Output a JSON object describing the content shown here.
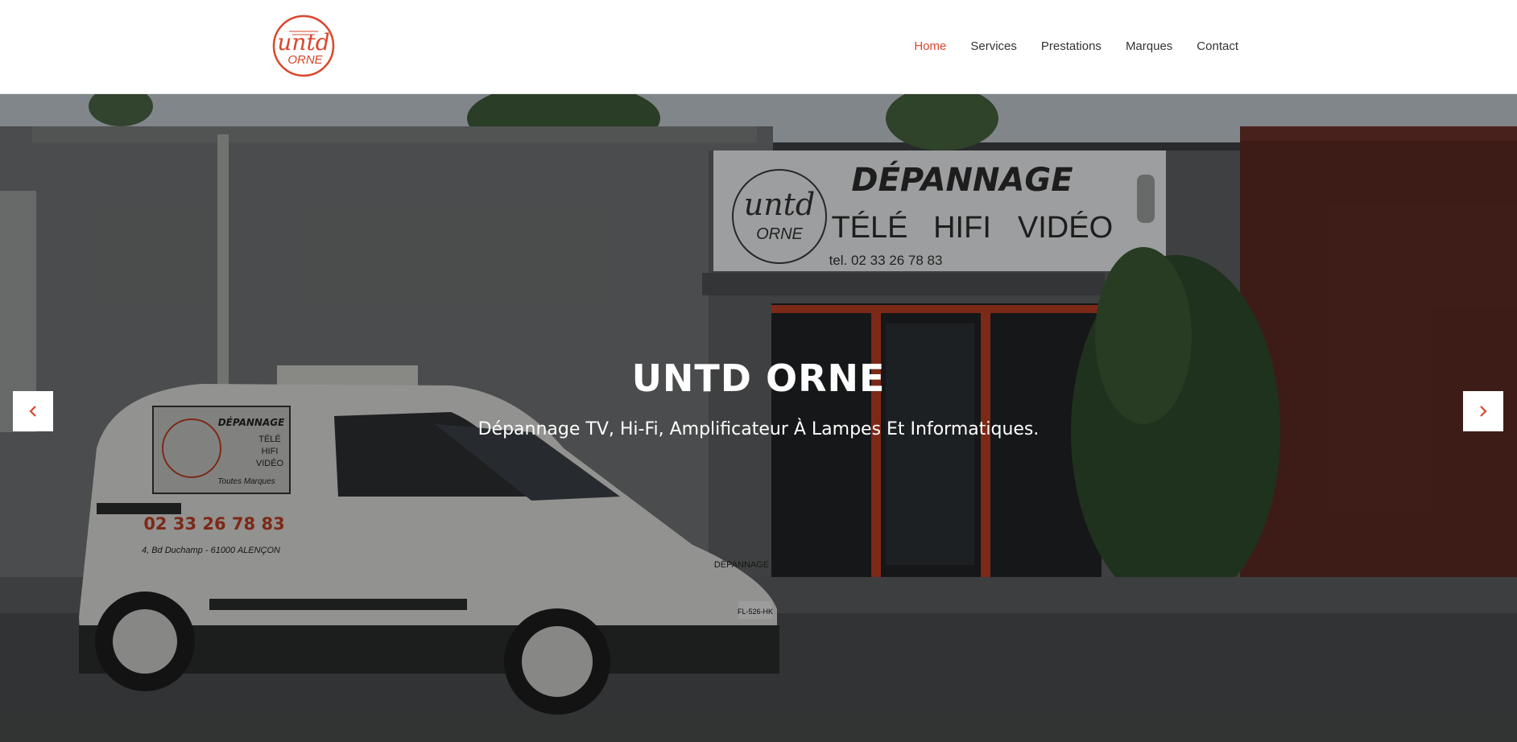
{
  "brand": {
    "logo_text_top": "untd",
    "logo_text_bottom": "ORNE",
    "accent_color": "#d9472b"
  },
  "nav": {
    "items": [
      {
        "label": "Home",
        "active": true
      },
      {
        "label": "Services",
        "active": false
      },
      {
        "label": "Prestations",
        "active": false
      },
      {
        "label": "Marques",
        "active": false
      },
      {
        "label": "Contact",
        "active": false
      }
    ]
  },
  "hero": {
    "title": "UNTD ORNE",
    "subtitle": "Dépannage TV, Hi-Fi, Amplificateur À Lampes Et Informatiques.",
    "prev_icon": "chevron-left-icon",
    "next_icon": "chevron-right-icon",
    "photo": {
      "sign_title": "DÉPANNAGE",
      "sign_items": [
        "TÉLÉ",
        "HIFI",
        "VIDÉO"
      ],
      "sign_phone": "tel. 02 33 26 78 83",
      "sign_logo_top": "untd",
      "sign_logo_bottom": "ORNE",
      "van_panel_title": "DÉPANNAGE",
      "van_panel_items": [
        "TÉLÉ",
        "HIFI",
        "VIDÉO"
      ],
      "van_panel_footer": "Toutes Marques",
      "van_phone": "02 33 26 78 83",
      "van_address": "4, Bd Duchamp - 61000 ALENÇON",
      "van_hood_text": "DÉPANNAGE",
      "van_plate": "FL-526-HK"
    }
  }
}
